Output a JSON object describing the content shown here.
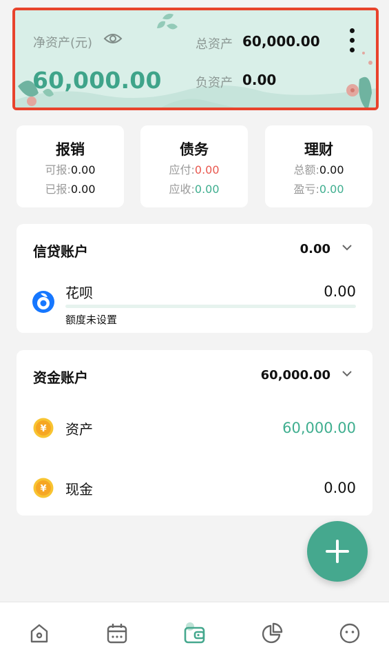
{
  "header": {
    "net_assets_label": "净资产(元)",
    "net_assets_value": "60,000.00",
    "total_assets_label": "总资产",
    "total_assets_value": "60,000.00",
    "negative_assets_label": "负资产",
    "negative_assets_value": "0.00",
    "eye_icon": "eye-icon",
    "more_icon": "more-vertical-icon"
  },
  "summary": [
    {
      "title": "报销",
      "row1_label": "可报:",
      "row1_value": "0.00",
      "row2_label": "已报:",
      "row2_value": "0.00"
    },
    {
      "title": "债务",
      "row1_label": "应付:",
      "row1_value": "0.00",
      "row2_label": "应收:",
      "row2_value": "0.00"
    },
    {
      "title": "理财",
      "row1_label": "总额:",
      "row1_value": "0.00",
      "row2_label": "盈亏:",
      "row2_value": "0.00"
    }
  ],
  "credit": {
    "title": "信贷账户",
    "total": "0.00",
    "item": {
      "name": "花呗",
      "value": "0.00",
      "note": "额度未设置",
      "icon": "huabei-icon"
    }
  },
  "fund": {
    "title": "资金账户",
    "total": "60,000.00",
    "items": [
      {
        "label": "资产",
        "value": "60,000.00",
        "icon": "yuan-coin-icon"
      },
      {
        "label": "现金",
        "value": "0.00",
        "icon": "yuan-coin-icon"
      }
    ]
  },
  "fab_icon": "plus-icon",
  "nav": [
    "home-icon",
    "calendar-icon",
    "wallet-icon",
    "pie-chart-icon",
    "profile-icon"
  ],
  "colors": {
    "accent": "#45a88e",
    "net_value": "#3fa48a",
    "payable": "#e9584f",
    "positive": "#3fae8f",
    "highlight_border": "#e8432c",
    "background": "#f3f3f3"
  }
}
